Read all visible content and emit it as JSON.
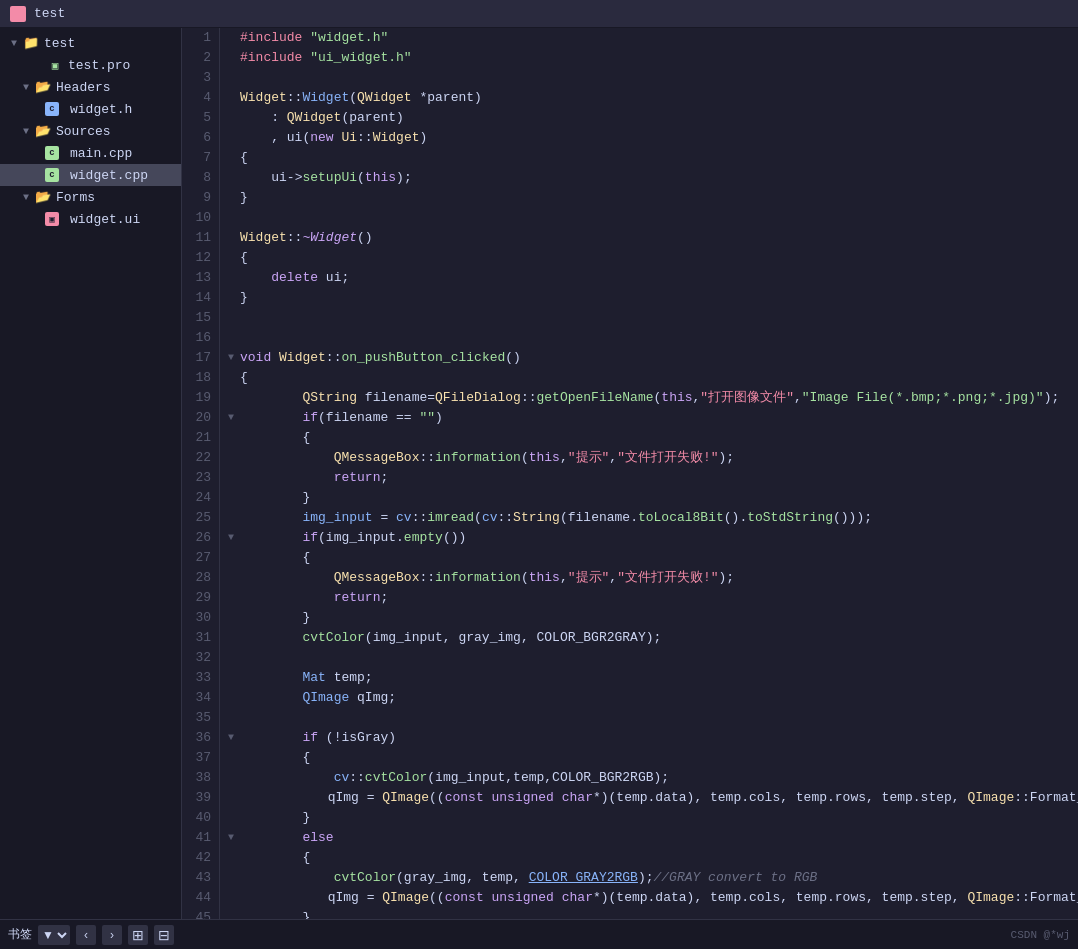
{
  "titleBar": {
    "projectName": "test"
  },
  "sidebar": {
    "items": [
      {
        "id": "project-root",
        "label": "test",
        "indent": 1,
        "type": "project",
        "expanded": true,
        "hasChevron": true
      },
      {
        "id": "test-pro",
        "label": "test.pro",
        "indent": 2,
        "type": "pro",
        "expanded": false,
        "hasChevron": false
      },
      {
        "id": "headers",
        "label": "Headers",
        "indent": 1,
        "type": "folder",
        "expanded": true,
        "hasChevron": true
      },
      {
        "id": "widget-h",
        "label": "widget.h",
        "indent": 2,
        "type": "h",
        "expanded": false,
        "hasChevron": false
      },
      {
        "id": "sources",
        "label": "Sources",
        "indent": 1,
        "type": "folder",
        "expanded": true,
        "hasChevron": true
      },
      {
        "id": "main-cpp",
        "label": "main.cpp",
        "indent": 2,
        "type": "cpp",
        "expanded": false,
        "hasChevron": false
      },
      {
        "id": "widget-cpp",
        "label": "widget.cpp",
        "indent": 2,
        "type": "cpp",
        "expanded": false,
        "hasChevron": false,
        "selected": true
      },
      {
        "id": "forms",
        "label": "Forms",
        "indent": 1,
        "type": "folder",
        "expanded": true,
        "hasChevron": true
      },
      {
        "id": "widget-ui",
        "label": "widget.ui",
        "indent": 2,
        "type": "ui",
        "expanded": false,
        "hasChevron": false
      }
    ]
  },
  "bottomBar": {
    "bookmarkLabel": "书签",
    "watermark": "CSDN @*wj"
  },
  "colorHighlight": "COLOR"
}
